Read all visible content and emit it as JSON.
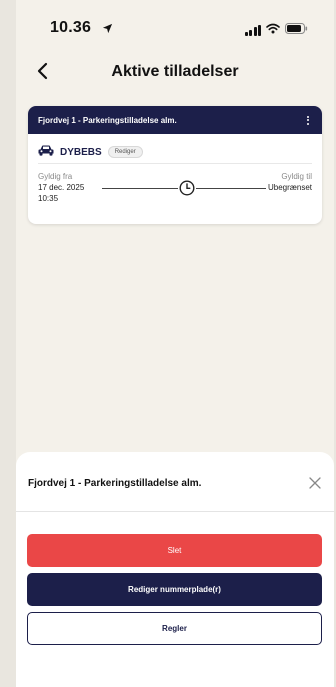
{
  "status_bar": {
    "time": "10.36"
  },
  "header": {
    "title": "Aktive tilladelser"
  },
  "permit_card": {
    "title": "Fjordvej 1 - Parkeringstilladelse alm.",
    "plate": "DYBEBS",
    "edit_label": "Rediger",
    "valid_from_label": "Gyldig fra",
    "valid_from_date": "17 dec. 2025",
    "valid_from_time": "10:35",
    "valid_to_label": "Gyldig til",
    "valid_to_value": "Ubegrænset"
  },
  "sheet": {
    "title": "Fjordvej 1 - Parkeringstilladelse alm.",
    "delete_label": "Slet",
    "edit_plate_label": "Rediger nummerplade(r)",
    "rules_label": "Regler"
  },
  "colors": {
    "navy": "#1c1f4a",
    "danger": "#ea4747",
    "background": "#f4f1ea"
  },
  "icons": [
    "location-arrow-icon",
    "signal-icon",
    "wifi-icon",
    "battery-icon",
    "back-chevron-icon",
    "more-vertical-icon",
    "car-icon",
    "clock-icon",
    "close-icon"
  ]
}
